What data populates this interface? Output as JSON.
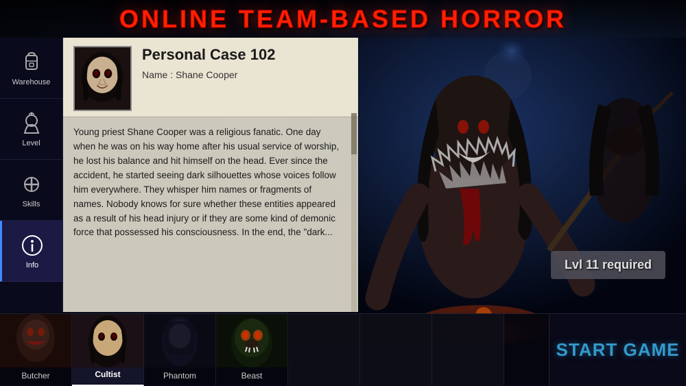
{
  "title": "ONLINE TEAM-BASED HORROR",
  "sidebar": {
    "items": [
      {
        "id": "warehouse",
        "label": "Warehouse",
        "icon": "backpack",
        "active": false
      },
      {
        "id": "level",
        "label": "Level",
        "icon": "person-up",
        "active": false
      },
      {
        "id": "skills",
        "label": "Skills",
        "icon": "cross",
        "active": false
      },
      {
        "id": "info",
        "label": "Info",
        "icon": "info",
        "active": true
      }
    ]
  },
  "character_panel": {
    "case_title": "Personal Case 102",
    "name_label": "Name : Shane Cooper",
    "description": "Young priest Shane Cooper was a religious fanatic. One day when he was on his way home after his usual service of worship, he lost his balance and hit himself on the head. Ever since the accident, he started seeing dark silhouettes whose voices follow him everywhere. They whisper him names or fragments of names. Nobody knows for sure whether these entities appeared as a result of his head injury or if they are some kind of demonic force that possessed his consciousness. In the end, the \"dark..."
  },
  "level_badge": "Lvl 11 required",
  "characters": [
    {
      "id": "butcher",
      "name": "Butcher",
      "selected": false
    },
    {
      "id": "cultist",
      "name": "Cultist",
      "selected": true
    },
    {
      "id": "phantom",
      "name": "Phantom",
      "selected": false
    },
    {
      "id": "beast",
      "name": "Beast",
      "selected": false
    }
  ],
  "start_button": "START GAME",
  "colors": {
    "title_red": "#ff2200",
    "accent_blue": "#3399cc",
    "sidebar_active": "#4488ff"
  }
}
